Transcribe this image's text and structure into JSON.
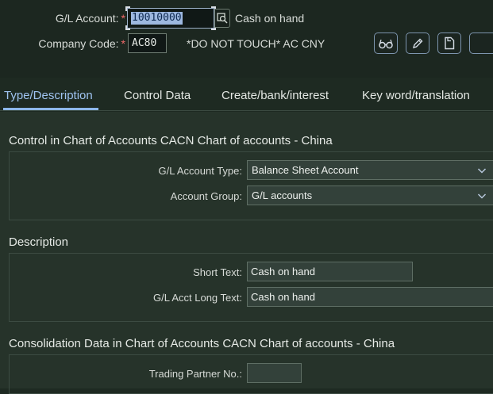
{
  "header": {
    "gl_account_label": "G/L Account:",
    "gl_account_value": "10010000",
    "gl_account_description": "Cash on hand",
    "company_code_label": "Company Code:",
    "company_code_value": "AC80",
    "company_code_description": "*DO NOT TOUCH* AC CNY",
    "required_marker": "*"
  },
  "toolbar": {
    "buttons": [
      "display-icon",
      "edit-icon",
      "create-icon",
      "more"
    ]
  },
  "tabs": [
    {
      "label": "Type/Description",
      "active": true
    },
    {
      "label": "Control Data",
      "active": false
    },
    {
      "label": "Create/bank/interest",
      "active": false
    },
    {
      "label": "Key word/translation",
      "active": false
    }
  ],
  "sections": {
    "control": {
      "title": "Control in Chart of Accounts CACN Chart of accounts - China",
      "account_type_label": "G/L Account Type:",
      "account_type_value": "Balance Sheet Account",
      "account_group_label": "Account Group:",
      "account_group_value": "G/L accounts"
    },
    "description": {
      "title": "Description",
      "short_text_label": "Short Text:",
      "short_text_value": "Cash on hand",
      "long_text_label": "G/L Acct Long Text:",
      "long_text_value": "Cash on hand"
    },
    "consolidation": {
      "title": "Consolidation Data in Chart of Accounts CACN Chart of accounts - China",
      "trading_partner_label": "Trading Partner No.:",
      "trading_partner_value": ""
    }
  },
  "colors": {
    "background": "#1e2a22",
    "accent": "#8db7ea",
    "required": "#f06a6a"
  }
}
